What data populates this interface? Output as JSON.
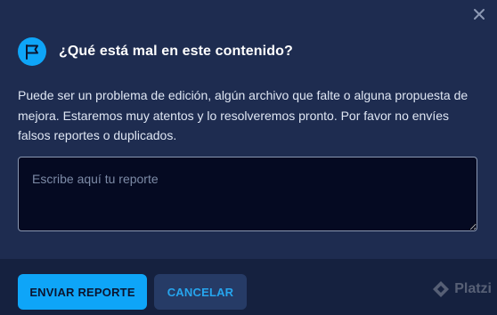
{
  "dialog": {
    "title": "¿Qué está mal en este contenido?",
    "description": "Puede ser un problema de edición, algún archivo que falte o alguna propuesta de mejora. Estaremos muy atentos y lo resolveremos pronto. Por favor no envíes falsos reportes o duplicados.",
    "flag_icon": "flag-icon",
    "close_icon": "close-icon"
  },
  "report": {
    "value": "",
    "placeholder": "Escribe aquí tu reporte"
  },
  "actions": {
    "send_label": "ENVIAR REPORTE",
    "cancel_label": "CANCELAR"
  },
  "brand": {
    "name": "Platzi"
  },
  "colors": {
    "background": "#1e2c50",
    "footer": "#15213f",
    "accent": "#0ea5f8",
    "input_background": "#050a22",
    "cancel_background": "#263b66"
  }
}
